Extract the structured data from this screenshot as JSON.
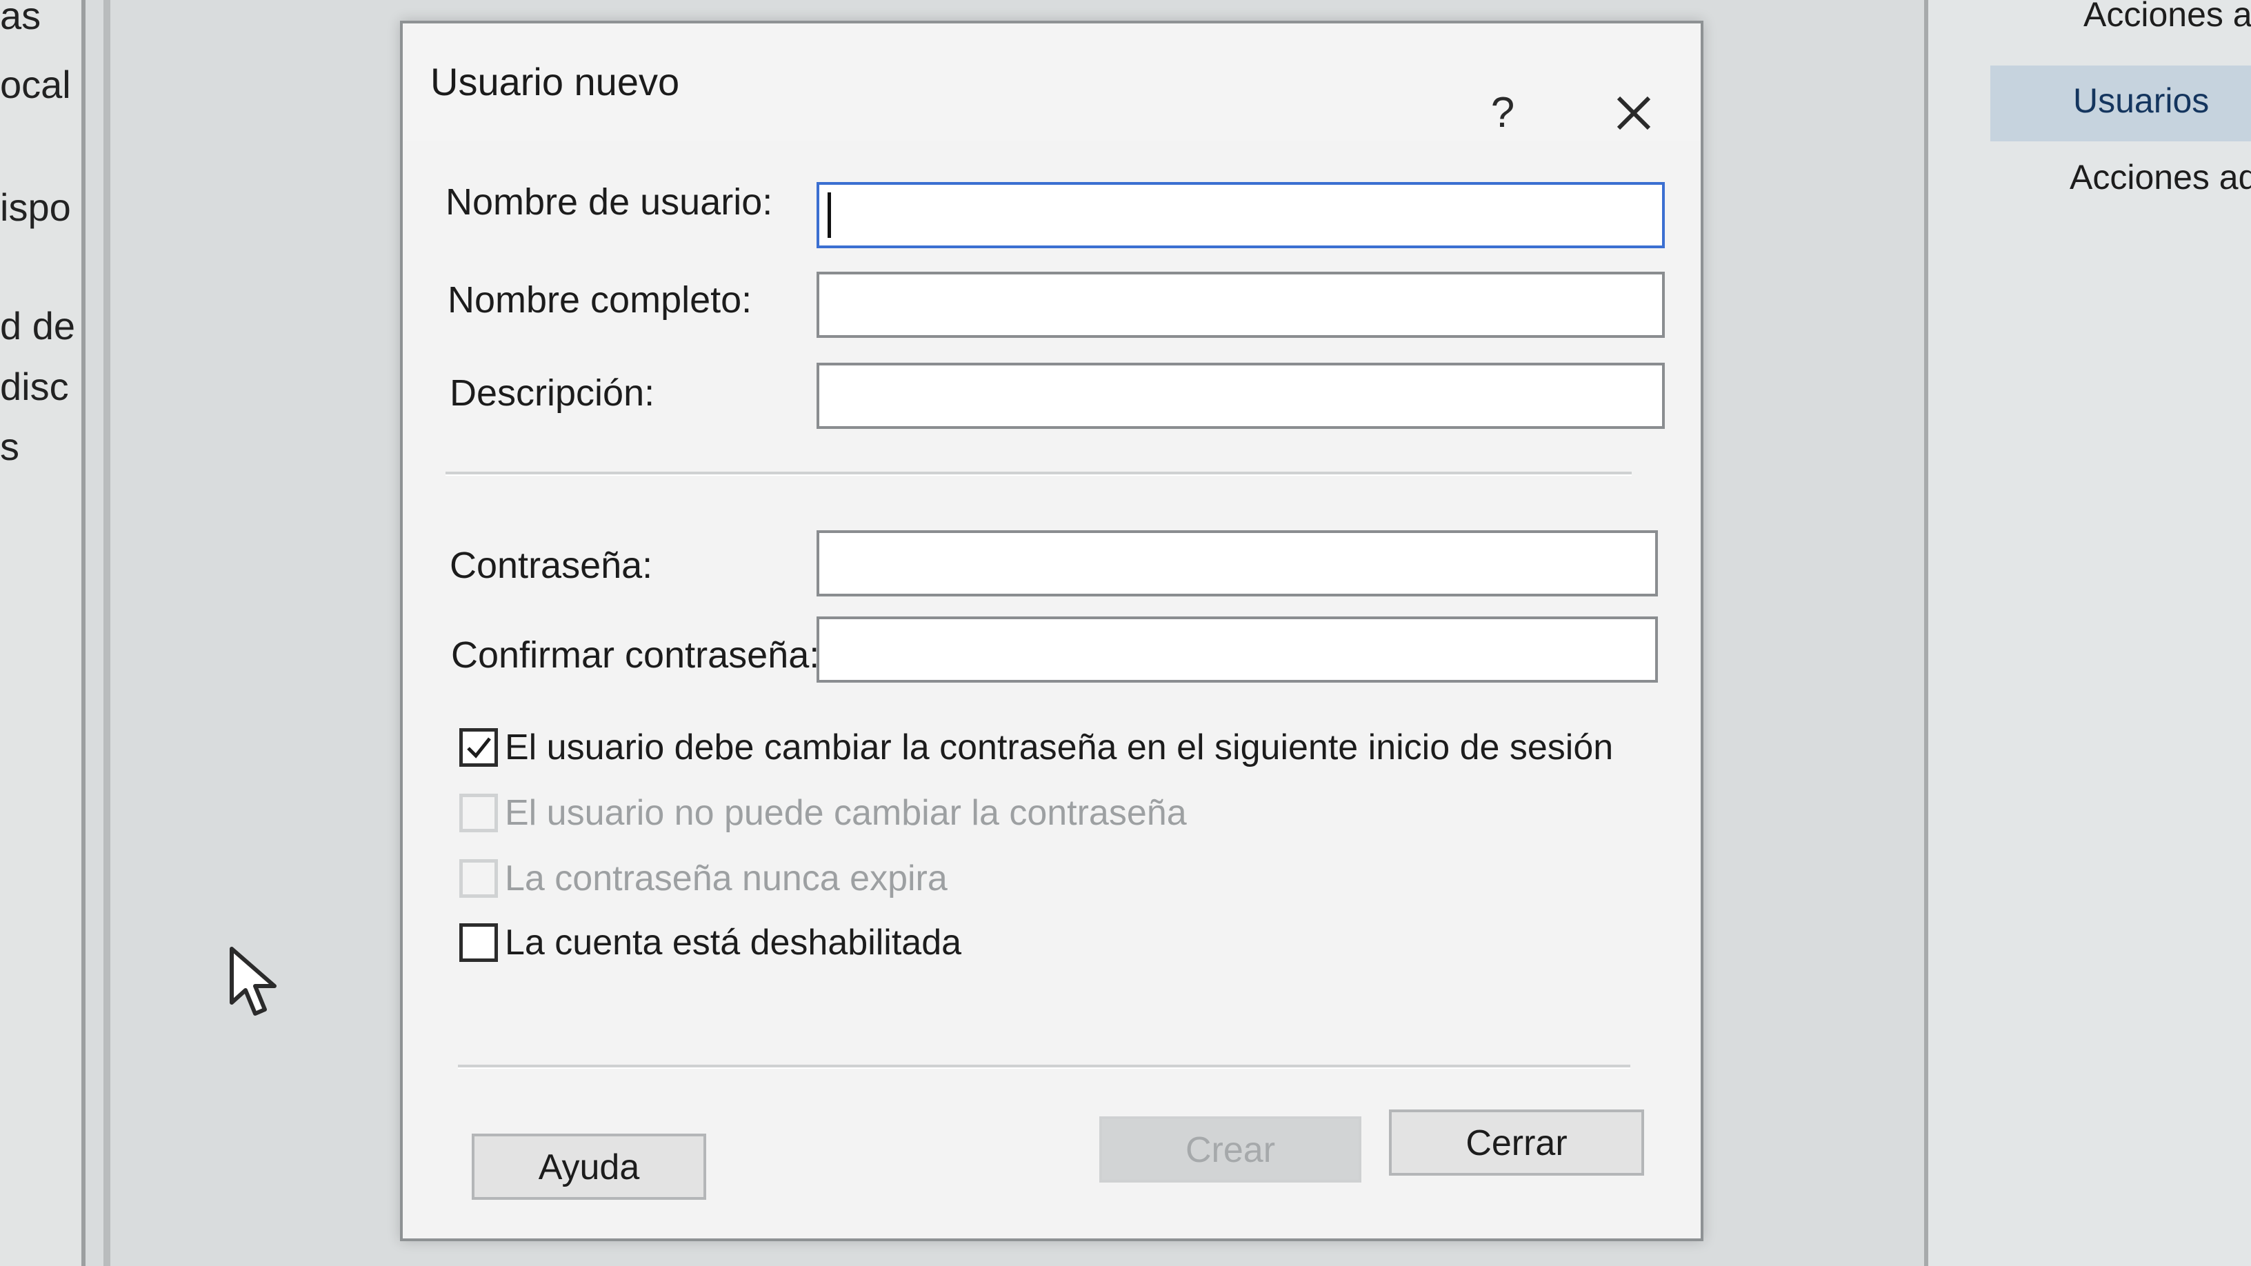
{
  "background": {
    "left_fragments": [
      "as",
      "ocal",
      "ispo",
      "d de",
      "disc",
      "s"
    ],
    "right_pane": {
      "header": "Acciones ad",
      "selected_item": "Usuarios",
      "sub_item": "Acciones ad"
    }
  },
  "dialog": {
    "title": "Usuario nuevo",
    "help_glyph": "?",
    "fields": {
      "username_label": "Nombre de usuario:",
      "username_value": "",
      "fullname_label": "Nombre completo:",
      "fullname_value": "",
      "description_label": "Descripción:",
      "description_value": "",
      "password_label": "Contraseña:",
      "password_value": "",
      "confirm_label": "Confirmar contraseña:",
      "confirm_value": ""
    },
    "checkboxes": [
      {
        "label": "El usuario debe cambiar la contraseña en el siguiente inicio de sesión",
        "checked": true,
        "enabled": true
      },
      {
        "label": "El usuario no puede cambiar la contraseña",
        "checked": false,
        "enabled": false
      },
      {
        "label": "La contraseña nunca expira",
        "checked": false,
        "enabled": false
      },
      {
        "label": "La cuenta está deshabilitada",
        "checked": false,
        "enabled": true
      }
    ],
    "buttons": {
      "help": "Ayuda",
      "create": "Crear",
      "close": "Cerrar"
    }
  },
  "colors": {
    "focus_border": "#3b6fd1",
    "selected_nav_bg": "#c6d3de"
  }
}
